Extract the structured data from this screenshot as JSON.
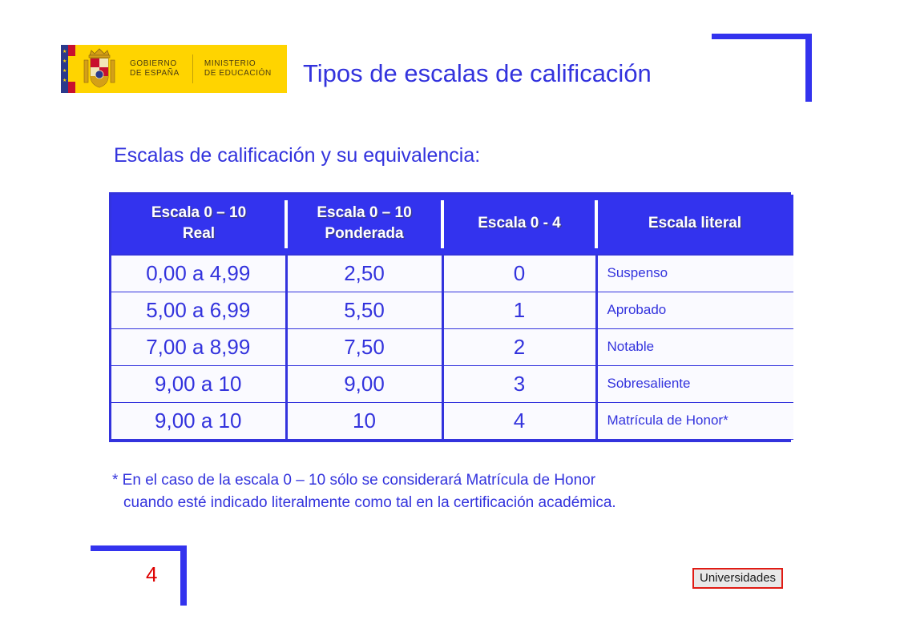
{
  "logo": {
    "gobierno_line1": "GOBIERNO",
    "gobierno_line2": "DE ESPAÑA",
    "ministerio_line1": "MINISTERIO",
    "ministerio_line2": "DE EDUCACIÓN",
    "background_color": "#FFD400",
    "text_color": "#4A3B12"
  },
  "header": {
    "title": "Tipos de escalas de calificación",
    "title_color": "#3333DD"
  },
  "subtitle": "Escalas de calificación y su equivalencia:",
  "table": {
    "columns": [
      {
        "line1": "Escala 0 – 10",
        "line2": "Real"
      },
      {
        "line1": "Escala 0 – 10",
        "line2": "Ponderada"
      },
      {
        "line1": "Escala 0 - 4",
        "line2": ""
      },
      {
        "line1": "Escala literal",
        "line2": ""
      }
    ],
    "rows": [
      {
        "real": "0,00 a 4,99",
        "ponderada": "2,50",
        "escala04": "0",
        "literal": "Suspenso"
      },
      {
        "real": "5,00 a 6,99",
        "ponderada": "5,50",
        "escala04": "1",
        "literal": "Aprobado"
      },
      {
        "real": "7,00 a 8,99",
        "ponderada": "7,50",
        "escala04": "2",
        "literal": "Notable"
      },
      {
        "real": "9,00 a 10",
        "ponderada": "9,00",
        "escala04": "3",
        "literal": "Sobresaliente"
      },
      {
        "real": "9,00 a 10",
        "ponderada": "10",
        "escala04": "4",
        "literal": "Matrícula de Honor*"
      }
    ],
    "header_bg": "#3333EE",
    "header_text_color": "#FFFFFF",
    "body_text_color": "#3333DD",
    "border_color": "#3333DD"
  },
  "footnote": {
    "line1": "* En el caso de la escala 0 – 10 sólo se considerará Matrícula de Honor",
    "line2": "cuando esté indicado literalmente como tal en la certificación académica."
  },
  "footer": {
    "page_number": "4",
    "page_number_color": "#DD0000",
    "badge_label": "Universidades",
    "badge_border_color": "#E01B14",
    "badge_bg": "#E8E8E8"
  },
  "decorations": {
    "bracket_color": "#3333EE"
  }
}
